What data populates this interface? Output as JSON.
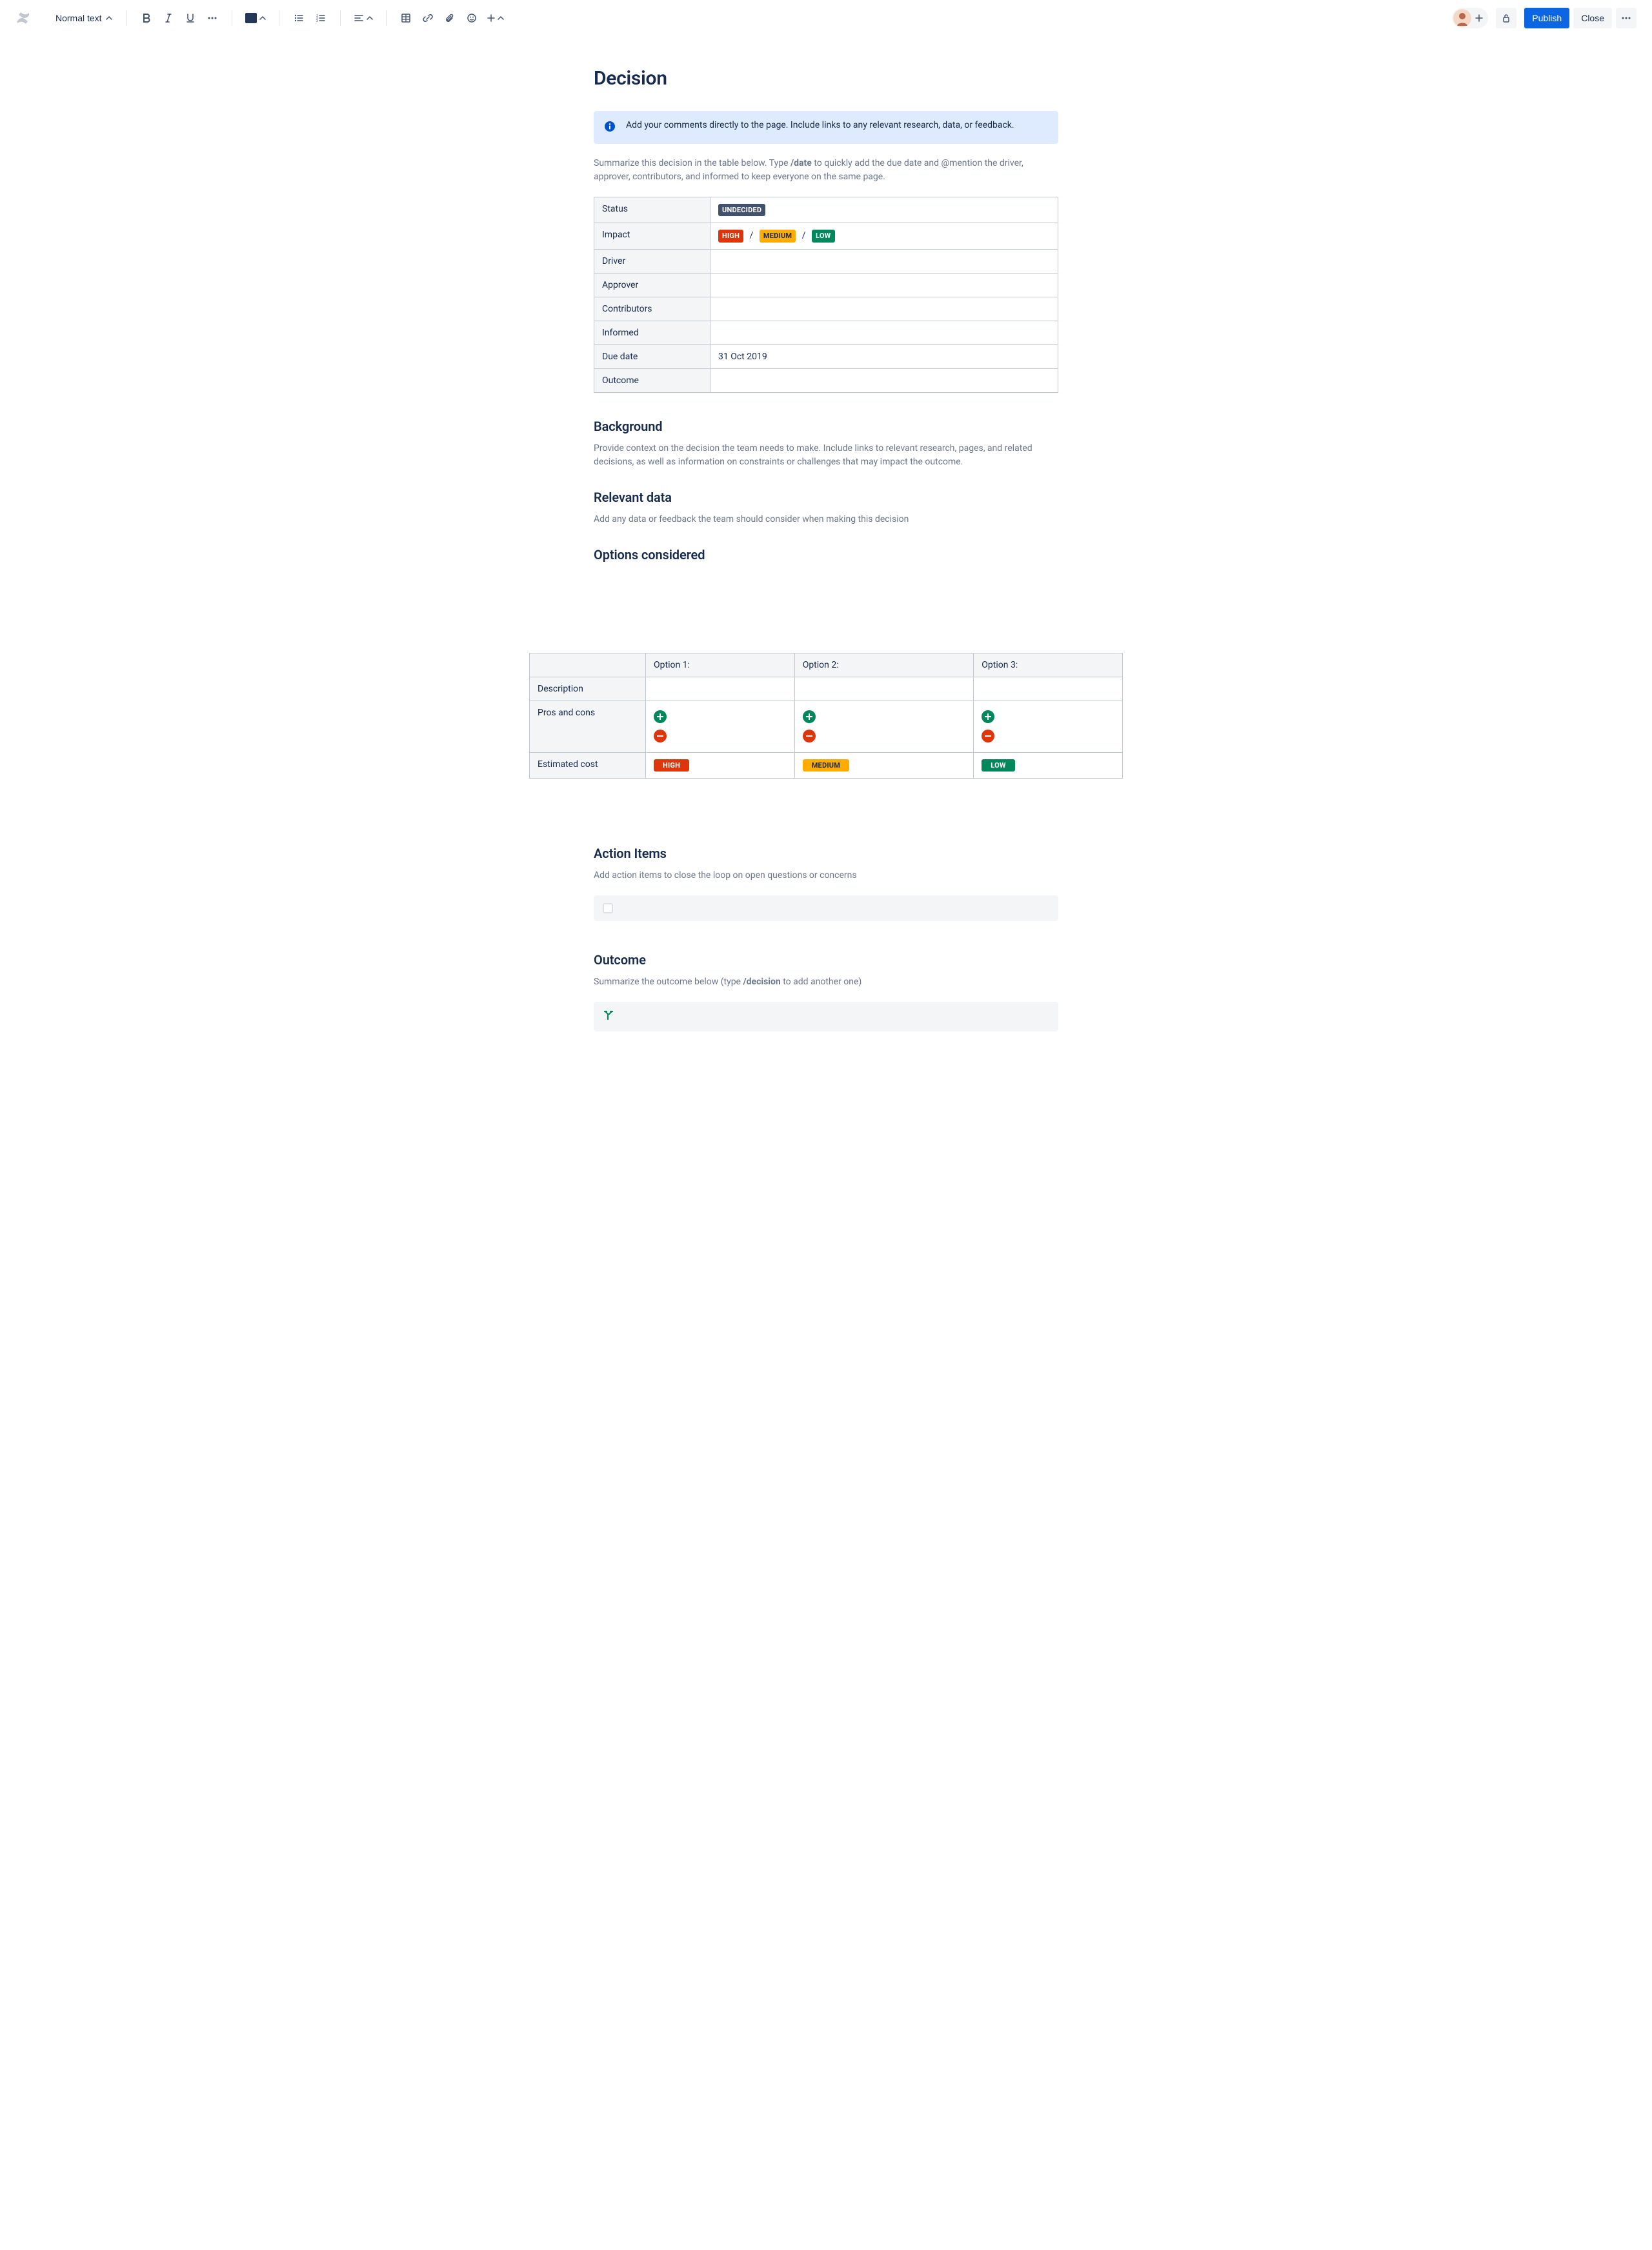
{
  "toolbar": {
    "text_style": "Normal text",
    "publish": "Publish",
    "close": "Close"
  },
  "doc": {
    "title": "Decision",
    "info_panel": "Add your comments directly to the page. Include links to any relevant research, data, or feedback.",
    "intro_before": "Summarize this decision in the table below. Type ",
    "intro_cmd": "/date",
    "intro_after": " to quickly add the due date and @mention the driver, approver, contributors, and informed to keep everyone on the same page.",
    "summary_rows": {
      "status": {
        "label": "Status",
        "pill": "UNDECIDED"
      },
      "impact": {
        "label": "Impact",
        "high": "HIGH",
        "medium": "MEDIUM",
        "low": "LOW",
        "sep": "/"
      },
      "driver": {
        "label": "Driver"
      },
      "approver": {
        "label": "Approver"
      },
      "contributors": {
        "label": "Contributors"
      },
      "informed": {
        "label": "Informed"
      },
      "due": {
        "label": "Due date",
        "value": "31 Oct 2019"
      },
      "outcome": {
        "label": "Outcome"
      }
    },
    "background": {
      "heading": "Background",
      "body": "Provide context on the decision the team needs to make. Include links to relevant research, pages, and related decisions, as well as information on constraints or challenges that may impact the outcome."
    },
    "relevant": {
      "heading": "Relevant data",
      "body": "Add any data or feedback the team should consider when making this decision"
    },
    "options": {
      "heading": "Options considered",
      "col_blank": "",
      "col1": "Option 1:",
      "col2": "Option 2:",
      "col3": "Option 3:",
      "row_desc": "Description",
      "row_pc": "Pros and cons",
      "row_cost": "Estimated cost",
      "cost1": "HIGH",
      "cost2": "MEDIUM",
      "cost3": "LOW"
    },
    "action": {
      "heading": "Action Items",
      "body": "Add action items to close the loop on open questions or concerns"
    },
    "outcome": {
      "heading": "Outcome",
      "body_before": "Summarize the outcome below (type ",
      "body_cmd": "/decision",
      "body_after": " to add another one)"
    }
  }
}
